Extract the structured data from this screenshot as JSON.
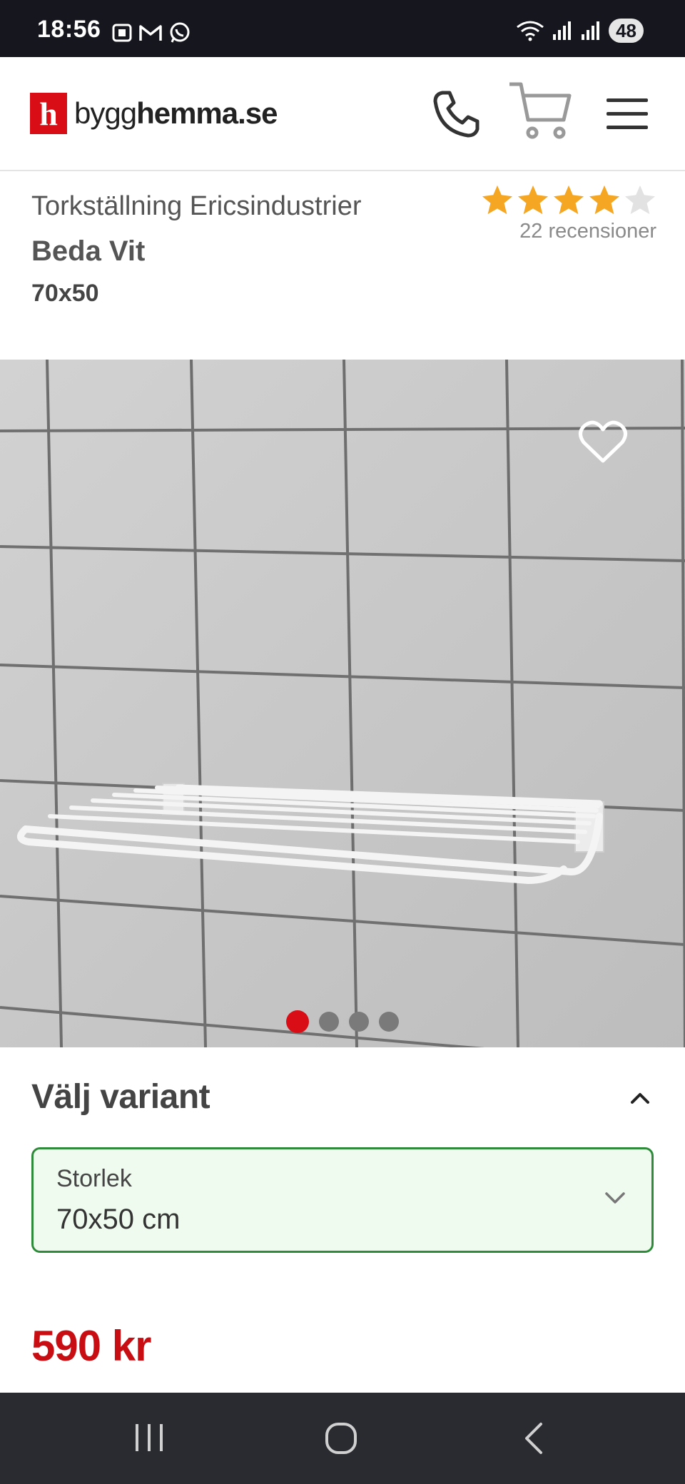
{
  "status_bar": {
    "time": "18:56",
    "left_icons": [
      "screenshot-icon",
      "gmail-icon",
      "whatsapp-icon"
    ],
    "right_icons": [
      "wifi-icon",
      "signal-icon",
      "signal-icon"
    ],
    "battery": "48"
  },
  "header": {
    "logo_mark": "h",
    "logo_text_light": "bygg",
    "logo_text_bold": "hemma",
    "logo_text_suffix": ".se",
    "icons": [
      "phone-icon",
      "cart-icon",
      "menu-icon"
    ],
    "brand_color": "#d90d15"
  },
  "product": {
    "title_line": "Torkställning Ericsindustrier",
    "name": "Beda Vit",
    "size": "70x50",
    "rating": 4,
    "rating_max": 5,
    "reviews": "22 recensioner",
    "image_count": 4,
    "active_image": 1
  },
  "variant": {
    "title": "Välj variant",
    "label": "Storlek",
    "value": "70x50 cm"
  },
  "price": "590 kr",
  "colors": {
    "star": "#f5a623",
    "price": "#c80e13",
    "select_border": "#2e8b3a"
  }
}
